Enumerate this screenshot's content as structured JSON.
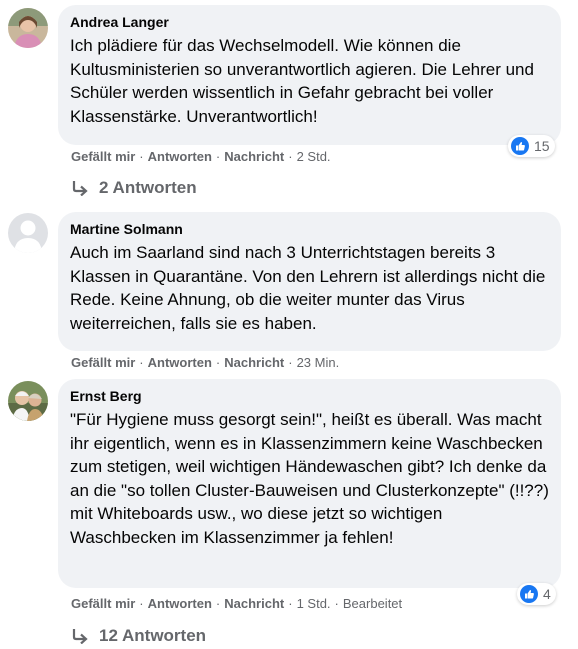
{
  "comments": [
    {
      "author": "Andrea Langer",
      "text": "Ich plädiere für das Wechselmodell. Wie können die Kultusministerien so unverantwortlich agieren. Die Lehrer und Schüler werden wissentlich in Gefahr gebracht bei voller Klassenstärke. Unverantwortlich!",
      "like_label": "Gefällt mir",
      "reply_label": "Antworten",
      "message_label": "Nachricht",
      "time": "2 Std.",
      "reaction_count": "15",
      "replies_label": "2 Antworten"
    },
    {
      "author": "Martine Solmann",
      "text": "Auch im Saarland sind nach 3 Unterrichtstagen bereits 3 Klassen in Quarantäne. Von den Lehrern ist allerdings nicht die Rede. Keine Ahnung, ob die weiter munter das Virus weiterreichen, falls sie es haben.",
      "like_label": "Gefällt mir",
      "reply_label": "Antworten",
      "message_label": "Nachricht",
      "time": "23 Min."
    },
    {
      "author": "Ernst Berg",
      "text": "\"Für Hygiene muss gesorgt sein!\", heißt es überall. Was macht ihr eigentlich, wenn es in Klassenzimmern keine Waschbecken zum stetigen, weil wichtigen Händewaschen gibt? Ich denke da an die \"so tollen Cluster-Bauweisen und Clusterkonzepte\" (!!??) mit Whiteboards usw., wo diese jetzt so wichtigen Waschbecken im Klassenzimmer ja fehlen!",
      "like_label": "Gefällt mir",
      "reply_label": "Antworten",
      "message_label": "Nachricht",
      "time": "1 Std.",
      "edited_label": "Bearbeitet",
      "reaction_count": "4",
      "replies_label": "12 Antworten"
    }
  ],
  "colors": {
    "bubble_bg": "#f0f2f5",
    "secondary_text": "#65676b",
    "like_blue": "#1877f2"
  },
  "icons": {
    "reaction": "like-thumbs-up-icon",
    "reply": "reply-arrow-icon"
  }
}
